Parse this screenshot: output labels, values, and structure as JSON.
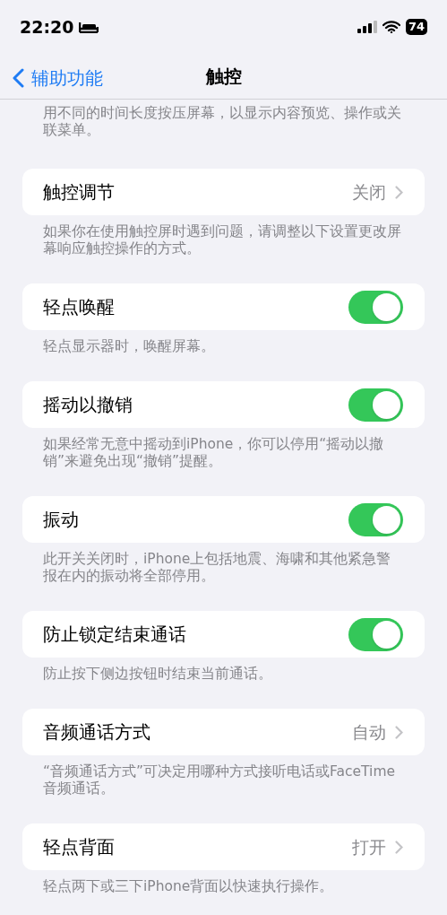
{
  "status_bar": {
    "time": "22:20",
    "battery": "74"
  },
  "nav": {
    "back": "辅助功能",
    "title": "触控"
  },
  "intro_note": "用不同的时间长度按压屏幕，以显示内容预览、操作或关联菜单。",
  "sections": [
    {
      "label": "触控调节",
      "kind": "disclosure",
      "value": "关闭",
      "note": "如果你在使用触控屏时遇到问题，请调整以下设置更改屏幕响应触控操作的方式。"
    },
    {
      "label": "轻点唤醒",
      "kind": "toggle",
      "on": true,
      "note": "轻点显示器时，唤醒屏幕。"
    },
    {
      "label": "摇动以撤销",
      "kind": "toggle",
      "on": true,
      "note": "如果经常无意中摇动到iPhone，你可以停用“摇动以撤销”来避免出现“撤销”提醒。"
    },
    {
      "label": "振动",
      "kind": "toggle",
      "on": true,
      "note": "此开关关闭时，iPhone上包括地震、海啸和其他紧急警报在内的振动将全部停用。"
    },
    {
      "label": "防止锁定结束通话",
      "kind": "toggle",
      "on": true,
      "note": "防止按下侧边按钮时结束当前通话。"
    },
    {
      "label": "音频通话方式",
      "kind": "disclosure",
      "value": "自动",
      "note": "“音频通话方式”可决定用哪种方式接听电话或FaceTime音频通话。"
    },
    {
      "label": "轻点背面",
      "kind": "disclosure",
      "value": "打开",
      "note": "轻点两下或三下iPhone背面以快速执行操作。"
    }
  ]
}
